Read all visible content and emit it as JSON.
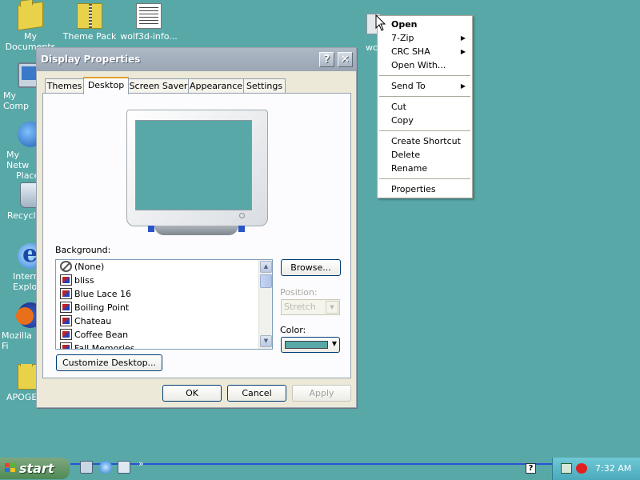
{
  "desktop": {
    "icons": [
      {
        "label": "My Documents",
        "icon": "folder-icon"
      },
      {
        "label": "Theme Pack",
        "icon": "zip-folder-icon"
      },
      {
        "label": "wolf3d-info...",
        "icon": "text-document-icon"
      },
      {
        "label": "My Comp",
        "icon": "my-computer-icon"
      },
      {
        "label": "My Netw",
        "icon": "network-places-icon"
      },
      {
        "label": "Place",
        "icon": ""
      },
      {
        "label": "Recycle",
        "icon": "recycle-bin-icon"
      },
      {
        "label": "Intern",
        "icon": "internet-explorer-icon"
      },
      {
        "label": "Explo",
        "icon": ""
      },
      {
        "label": "Mozilla Fi",
        "icon": "firefox-icon"
      },
      {
        "label": "APOGE",
        "icon": "folder-icon"
      }
    ],
    "selected_icon_label": "wo",
    "background_color": "#58a8a8"
  },
  "dialog": {
    "title": "Display Properties",
    "help_glyph": "?",
    "close_glyph": "✕",
    "tabs": [
      "Themes",
      "Desktop",
      "Screen Saver",
      "Appearance",
      "Settings"
    ],
    "active_tab": "Desktop",
    "background_label": "Background:",
    "backgrounds": [
      "(None)",
      "bliss",
      "Blue Lace 16",
      "Boiling Point",
      "Chateau",
      "Coffee Bean",
      "Fall Memories"
    ],
    "browse_label": "Browse...",
    "position_label": "Position:",
    "position_value": "Stretch",
    "color_label": "Color:",
    "color_value": "#58a8a8",
    "customize_label": "Customize Desktop...",
    "ok_label": "OK",
    "cancel_label": "Cancel",
    "apply_label": "Apply"
  },
  "context_menu": {
    "items": [
      {
        "label": "Open",
        "bold": true,
        "submenu": false
      },
      {
        "label": "7-Zip",
        "bold": false,
        "submenu": true
      },
      {
        "label": "CRC SHA",
        "bold": false,
        "submenu": true
      },
      {
        "label": "Open With...",
        "bold": false,
        "submenu": false
      },
      {
        "label": "Send To",
        "bold": false,
        "submenu": true
      },
      {
        "label": "Cut",
        "bold": false,
        "submenu": false
      },
      {
        "label": "Copy",
        "bold": false,
        "submenu": false
      },
      {
        "label": "Create Shortcut",
        "bold": false,
        "submenu": false
      },
      {
        "label": "Delete",
        "bold": false,
        "submenu": false
      },
      {
        "label": "Rename",
        "bold": false,
        "submenu": false
      },
      {
        "label": "Properties",
        "bold": false,
        "submenu": false
      }
    ],
    "submenu_glyph": "▶"
  },
  "taskbar": {
    "start_label": "start",
    "chevron": "»",
    "clock": "7:32 AM",
    "help_glyph": "?"
  }
}
